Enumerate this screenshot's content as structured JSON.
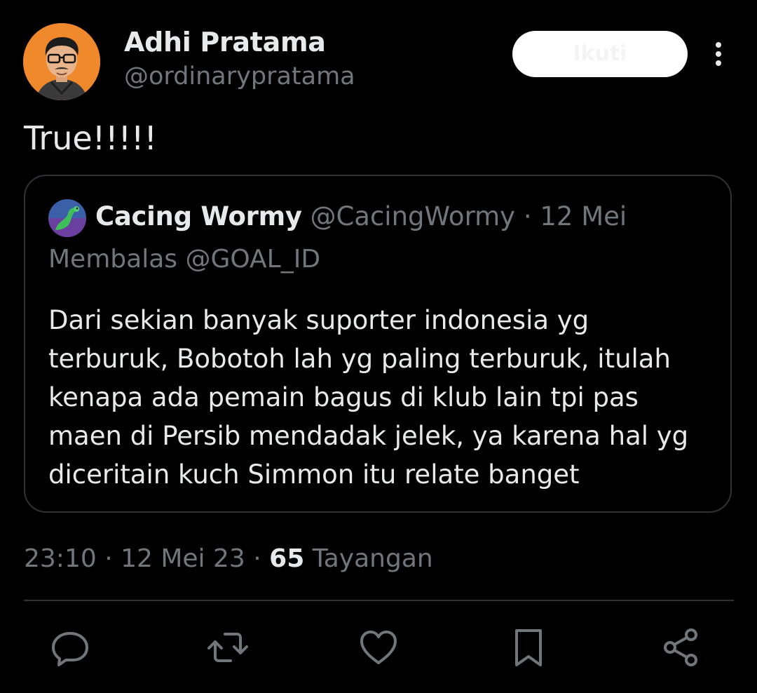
{
  "tweet": {
    "author": {
      "display_name": "Adhi Pratama",
      "handle": "@ordinarypratama",
      "avatar_icon": "bitmoji-avatar-icon"
    },
    "follow_button_label": "Ikuti",
    "more_icon": "more-vertical-icon",
    "text": "True!!!!!",
    "timestamp": "23:10 · 12 Mei 23",
    "meta_sep": " · ",
    "views_count": "65",
    "views_label": "Tayangan"
  },
  "quote": {
    "avatar_icon": "worm-avatar-icon",
    "display_name": "Cacing Wormy",
    "handle": "@CacingWormy",
    "sep": " · ",
    "date": "12 Mei",
    "reply_to": "Membalas @GOAL_ID",
    "body_lines": [
      "Dari sekian banyak suporter indonesia yg",
      "terburuk, Bobotoh lah yg paling terburuk, itulah",
      "kenapa ada pemain bagus di klub lain tpi pas",
      "maen di Persib mendadak jelek, ya karena hal yg",
      "diceritain kuch Simmon itu relate banget"
    ]
  },
  "actions": [
    {
      "icon": "reply-icon"
    },
    {
      "icon": "retweet-icon"
    },
    {
      "icon": "like-icon"
    },
    {
      "icon": "bookmark-icon"
    },
    {
      "icon": "share-icon"
    }
  ],
  "colors": {
    "background": "#000000",
    "primary_text": "#e7e9ea",
    "secondary_text": "#71767b",
    "border": "#2f3336",
    "follow_button": "#ffffff"
  }
}
